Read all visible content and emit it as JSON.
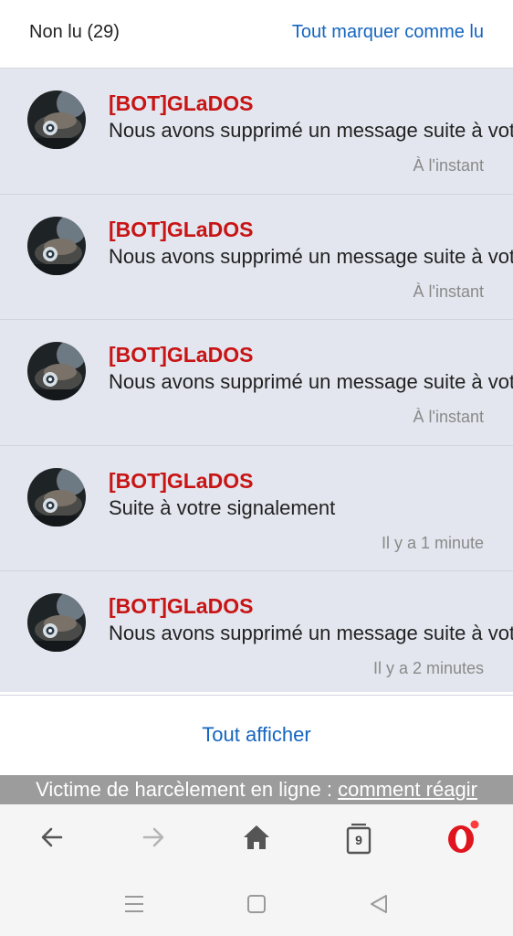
{
  "header": {
    "unread_label": "Non lu (29)",
    "mark_all_read": "Tout marquer comme lu"
  },
  "notifications": [
    {
      "author": "[BOT]GLaDOS",
      "message": "Nous avons supprimé un message suite à votre signalement",
      "time": "À l'instant"
    },
    {
      "author": "[BOT]GLaDOS",
      "message": "Nous avons supprimé un message suite à votre signalement",
      "time": "À l'instant"
    },
    {
      "author": "[BOT]GLaDOS",
      "message": "Nous avons supprimé un message suite à votre signalement",
      "time": "À l'instant"
    },
    {
      "author": "[BOT]GLaDOS",
      "message": "Suite à votre signalement",
      "time": "Il y a 1 minute"
    },
    {
      "author": "[BOT]GLaDOS",
      "message": "Nous avons supprimé un message suite à votre signalement",
      "time": "Il y a 2 minutes"
    }
  ],
  "footer": {
    "show_all": "Tout afficher"
  },
  "banner": {
    "text": "Victime de harcèlement en ligne : ",
    "link": "comment réagir"
  },
  "browser_bar": {
    "back_icon": "arrow-left-icon",
    "forward_icon": "arrow-right-icon",
    "home_icon": "home-icon",
    "tabs_icon": "tabs-icon",
    "tabs_count": "9",
    "menu_icon": "opera-logo-icon"
  },
  "colors": {
    "accent": "#1565c0",
    "author": "#c81414",
    "list_bg": "#e3e6ee",
    "banner_bg": "#9c9c9c",
    "opera_red": "#e0161f"
  }
}
